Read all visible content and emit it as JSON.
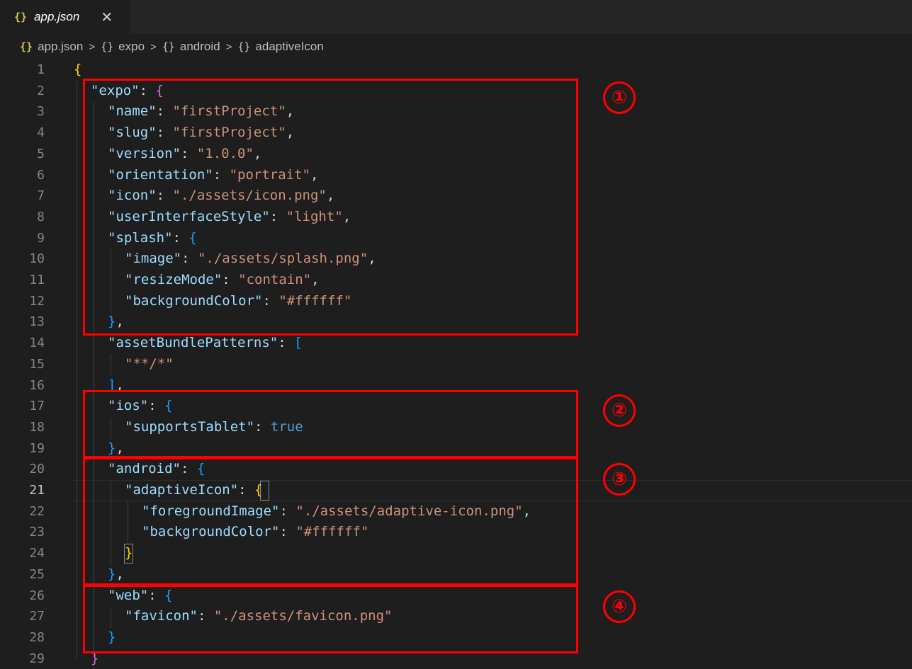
{
  "tab": {
    "icon": "json-braces-icon",
    "title": "app.json",
    "close_glyph": "✕"
  },
  "breadcrumb": [
    {
      "icon": "{}",
      "label": "app.json"
    },
    {
      "icon": "{}",
      "label": "expo"
    },
    {
      "icon": "{}",
      "label": "android"
    },
    {
      "icon": "{}",
      "label": "adaptiveIcon"
    }
  ],
  "active_line": 21,
  "lines": [
    {
      "n": "1",
      "parts": [
        [
          "br-y",
          "{"
        ]
      ]
    },
    {
      "n": "2",
      "parts": [
        [
          "k",
          "\"expo\""
        ],
        [
          "p",
          ": "
        ],
        [
          "br-p",
          "{"
        ]
      ]
    },
    {
      "n": "3",
      "parts": [
        [
          "k",
          "\"name\""
        ],
        [
          "p",
          ": "
        ],
        [
          "s",
          "\"firstProject\""
        ],
        [
          "p",
          ","
        ]
      ]
    },
    {
      "n": "4",
      "parts": [
        [
          "k",
          "\"slug\""
        ],
        [
          "p",
          ": "
        ],
        [
          "s",
          "\"firstProject\""
        ],
        [
          "p",
          ","
        ]
      ]
    },
    {
      "n": "5",
      "parts": [
        [
          "k",
          "\"version\""
        ],
        [
          "p",
          ": "
        ],
        [
          "s",
          "\"1.0.0\""
        ],
        [
          "p",
          ","
        ]
      ]
    },
    {
      "n": "6",
      "parts": [
        [
          "k",
          "\"orientation\""
        ],
        [
          "p",
          ": "
        ],
        [
          "s",
          "\"portrait\""
        ],
        [
          "p",
          ","
        ]
      ]
    },
    {
      "n": "7",
      "parts": [
        [
          "k",
          "\"icon\""
        ],
        [
          "p",
          ": "
        ],
        [
          "s",
          "\"./assets/icon.png\""
        ],
        [
          "p",
          ","
        ]
      ]
    },
    {
      "n": "8",
      "parts": [
        [
          "k",
          "\"userInterfaceStyle\""
        ],
        [
          "p",
          ": "
        ],
        [
          "s",
          "\"light\""
        ],
        [
          "p",
          ","
        ]
      ]
    },
    {
      "n": "9",
      "parts": [
        [
          "k",
          "\"splash\""
        ],
        [
          "p",
          ": "
        ],
        [
          "br-b",
          "{"
        ]
      ]
    },
    {
      "n": "10",
      "parts": [
        [
          "k",
          "\"image\""
        ],
        [
          "p",
          ": "
        ],
        [
          "s",
          "\"./assets/splash.png\""
        ],
        [
          "p",
          ","
        ]
      ]
    },
    {
      "n": "11",
      "parts": [
        [
          "k",
          "\"resizeMode\""
        ],
        [
          "p",
          ": "
        ],
        [
          "s",
          "\"contain\""
        ],
        [
          "p",
          ","
        ]
      ]
    },
    {
      "n": "12",
      "parts": [
        [
          "k",
          "\"backgroundColor\""
        ],
        [
          "p",
          ": "
        ],
        [
          "s",
          "\"#ffffff\""
        ]
      ]
    },
    {
      "n": "13",
      "parts": [
        [
          "br-b",
          "}"
        ],
        [
          "p",
          ","
        ]
      ]
    },
    {
      "n": "14",
      "parts": [
        [
          "k",
          "\"assetBundlePatterns\""
        ],
        [
          "p",
          ": "
        ],
        [
          "br-b",
          "["
        ]
      ]
    },
    {
      "n": "15",
      "parts": [
        [
          "s",
          "\"**/*\""
        ]
      ]
    },
    {
      "n": "16",
      "parts": [
        [
          "br-b",
          "]"
        ],
        [
          "p",
          ","
        ]
      ]
    },
    {
      "n": "17",
      "parts": [
        [
          "k",
          "\"ios\""
        ],
        [
          "p",
          ": "
        ],
        [
          "br-b",
          "{"
        ]
      ]
    },
    {
      "n": "18",
      "parts": [
        [
          "k",
          "\"supportsTablet\""
        ],
        [
          "p",
          ": "
        ],
        [
          "b",
          "true"
        ]
      ]
    },
    {
      "n": "19",
      "parts": [
        [
          "br-b",
          "}"
        ],
        [
          "p",
          ","
        ]
      ]
    },
    {
      "n": "20",
      "parts": [
        [
          "k",
          "\"android\""
        ],
        [
          "p",
          ": "
        ],
        [
          "br-b",
          "{"
        ]
      ]
    },
    {
      "n": "21",
      "parts": [
        [
          "k",
          "\"adaptiveIcon\""
        ],
        [
          "p",
          ": "
        ],
        [
          "br-y",
          "{"
        ]
      ]
    },
    {
      "n": "22",
      "parts": [
        [
          "k",
          "\"foregroundImage\""
        ],
        [
          "p",
          ": "
        ],
        [
          "s",
          "\"./assets/adaptive-icon.png\""
        ],
        [
          "p",
          ","
        ]
      ]
    },
    {
      "n": "23",
      "parts": [
        [
          "k",
          "\"backgroundColor\""
        ],
        [
          "p",
          ": "
        ],
        [
          "s",
          "\"#ffffff\""
        ]
      ]
    },
    {
      "n": "24",
      "parts": [
        [
          "br-y",
          "}"
        ]
      ]
    },
    {
      "n": "25",
      "parts": [
        [
          "br-b",
          "}"
        ],
        [
          "p",
          ","
        ]
      ]
    },
    {
      "n": "26",
      "parts": [
        [
          "k",
          "\"web\""
        ],
        [
          "p",
          ": "
        ],
        [
          "br-b",
          "{"
        ]
      ]
    },
    {
      "n": "27",
      "parts": [
        [
          "k",
          "\"favicon\""
        ],
        [
          "p",
          ": "
        ],
        [
          "s",
          "\"./assets/favicon.png\""
        ]
      ]
    },
    {
      "n": "28",
      "parts": [
        [
          "br-b",
          "}"
        ]
      ]
    },
    {
      "n": "29",
      "parts": [
        [
          "br-p",
          "}"
        ]
      ]
    }
  ],
  "annotations": [
    "①",
    "②",
    "③",
    "④"
  ]
}
